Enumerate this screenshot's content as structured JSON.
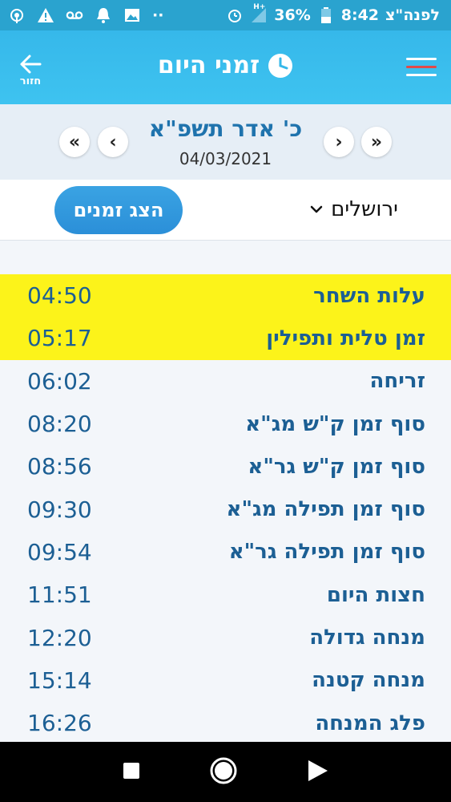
{
  "status_bar": {
    "time": "8:42",
    "carrier": "לפנה\"צ",
    "battery": "36%",
    "net": "H+",
    "dots": "··"
  },
  "header": {
    "title": "זמני היום",
    "back_label": "חזור"
  },
  "date_nav": {
    "hebrew_date": "כ' אדר תשפ\"א",
    "gregorian_date": "04/03/2021"
  },
  "controls": {
    "show_button": "הצג זמנים",
    "city": "ירושלים"
  },
  "times": [
    {
      "name": "עלות השחר",
      "time": "04:50",
      "highlight": true
    },
    {
      "name": "זמן טלית ותפילין",
      "time": "05:17",
      "highlight": true
    },
    {
      "name": "זריחה",
      "time": "06:02",
      "highlight": false
    },
    {
      "name": "סוף זמן ק\"ש מג\"א",
      "time": "08:20",
      "highlight": false
    },
    {
      "name": "סוף זמן ק\"ש גר\"א",
      "time": "08:56",
      "highlight": false
    },
    {
      "name": "סוף זמן תפילה מג\"א",
      "time": "09:30",
      "highlight": false
    },
    {
      "name": "סוף זמן תפילה גר\"א",
      "time": "09:54",
      "highlight": false
    },
    {
      "name": "חצות היום",
      "time": "11:51",
      "highlight": false
    },
    {
      "name": "מנחה גדולה",
      "time": "12:20",
      "highlight": false
    },
    {
      "name": "מנחה קטנה",
      "time": "15:14",
      "highlight": false
    },
    {
      "name": "פלג המנחה",
      "time": "16:26",
      "highlight": false
    }
  ],
  "colors": {
    "accent": "#3ec3f0",
    "highlight": "#fcf31a",
    "text": "#1c5f94"
  }
}
